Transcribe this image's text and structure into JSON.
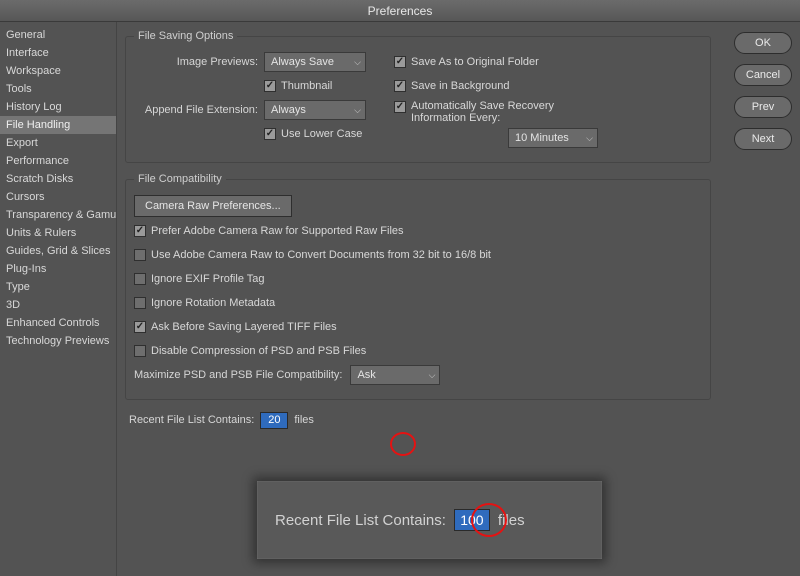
{
  "title": "Preferences",
  "sidebar": {
    "items": [
      {
        "label": "General"
      },
      {
        "label": "Interface"
      },
      {
        "label": "Workspace"
      },
      {
        "label": "Tools"
      },
      {
        "label": "History Log"
      },
      {
        "label": "File Handling"
      },
      {
        "label": "Export"
      },
      {
        "label": "Performance"
      },
      {
        "label": "Scratch Disks"
      },
      {
        "label": "Cursors"
      },
      {
        "label": "Transparency & Gamut"
      },
      {
        "label": "Units & Rulers"
      },
      {
        "label": "Guides, Grid & Slices"
      },
      {
        "label": "Plug-Ins"
      },
      {
        "label": "Type"
      },
      {
        "label": "3D"
      },
      {
        "label": "Enhanced Controls"
      },
      {
        "label": "Technology Previews"
      }
    ],
    "selected_index": 5
  },
  "buttons": {
    "ok": "OK",
    "cancel": "Cancel",
    "prev": "Prev",
    "next": "Next"
  },
  "file_saving": {
    "legend": "File Saving Options",
    "image_previews_label": "Image Previews:",
    "image_previews_value": "Always Save",
    "thumbnail_label": "Thumbnail",
    "append_ext_label": "Append File Extension:",
    "append_ext_value": "Always",
    "lowercase_label": "Use Lower Case",
    "save_original_label": "Save As to Original Folder",
    "save_background_label": "Save in Background",
    "auto_recovery_label": "Automatically Save Recovery Information Every:",
    "auto_recovery_value": "10 Minutes"
  },
  "file_compat": {
    "legend": "File Compatibility",
    "camera_raw_btn": "Camera Raw Preferences...",
    "prefer_acr_label": "Prefer Adobe Camera Raw for Supported Raw Files",
    "use_acr_convert_label": "Use Adobe Camera Raw to Convert Documents from 32 bit to 16/8 bit",
    "ignore_exif_label": "Ignore EXIF Profile Tag",
    "ignore_rotation_label": "Ignore Rotation Metadata",
    "ask_tiff_label": "Ask Before Saving Layered TIFF Files",
    "disable_psd_label": "Disable Compression of PSD and PSB Files",
    "maximize_label": "Maximize PSD and PSB File Compatibility:",
    "maximize_value": "Ask"
  },
  "recent": {
    "label": "Recent File List Contains:",
    "value": "20",
    "suffix": "files"
  },
  "zoom": {
    "label": "Recent File List Contains:",
    "value": "100",
    "suffix": "files"
  }
}
